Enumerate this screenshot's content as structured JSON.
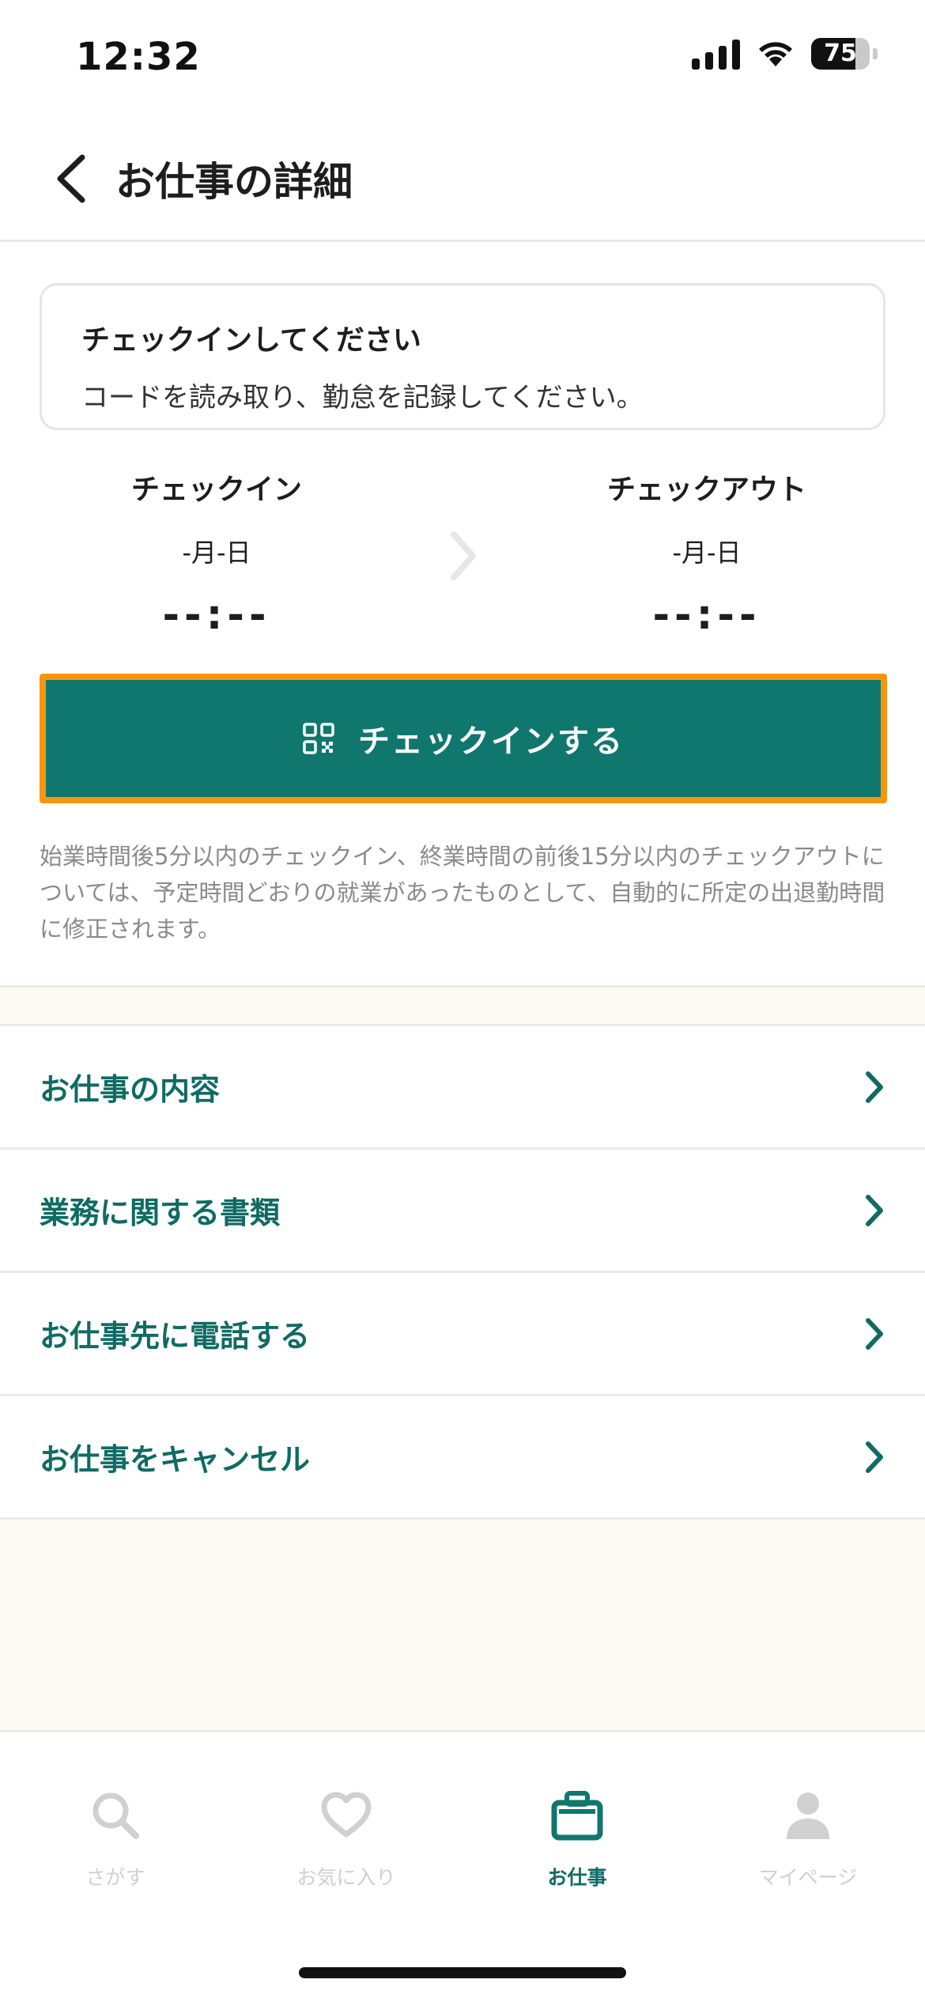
{
  "status_bar": {
    "time": "12:32",
    "battery": "75",
    "battery_level": 0.75
  },
  "header": {
    "title": "お仕事の詳細"
  },
  "notice": {
    "title": "チェックインしてください",
    "body": "コードを読み取り、勤怠を記録してください。"
  },
  "check_in": {
    "label": "チェックイン",
    "date": "-月-日",
    "time": "--:--"
  },
  "check_out": {
    "label": "チェックアウト",
    "date": "-月-日",
    "time": "--:--"
  },
  "checkin_button": {
    "label": "チェックインする"
  },
  "note": "始業時間後5分以内のチェックイン、終業時間の前後15分以内のチェックアウトについては、予定時間どおりの就業があったものとして、自動的に所定の出退勤時間に修正されます。",
  "menu": {
    "items": [
      {
        "label": "お仕事の内容"
      },
      {
        "label": "業務に関する書類"
      },
      {
        "label": "お仕事先に電話する"
      },
      {
        "label": "お仕事をキャンセル"
      }
    ]
  },
  "tabs": [
    {
      "label": "さがす",
      "icon": "search-icon"
    },
    {
      "label": "お気に入り",
      "icon": "heart-icon"
    },
    {
      "label": "お仕事",
      "icon": "briefcase-icon",
      "active": true
    },
    {
      "label": "マイページ",
      "icon": "person-icon"
    }
  ],
  "colors": {
    "accent": "#0f776e",
    "highlight": "#f5960f",
    "link": "#0f6b64"
  }
}
